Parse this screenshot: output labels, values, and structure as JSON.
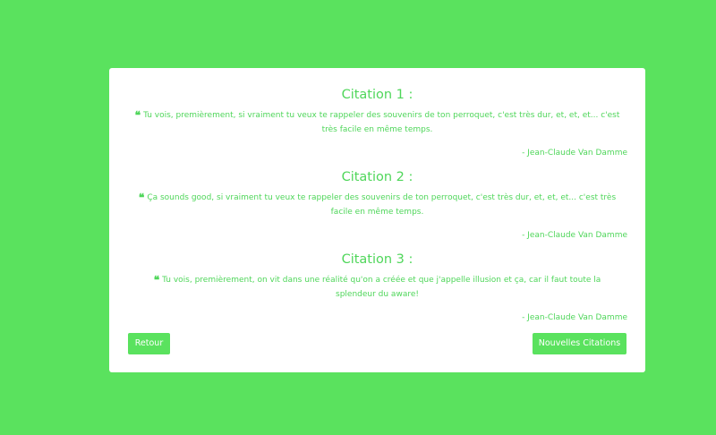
{
  "citations": [
    {
      "title": "Citation 1 :",
      "text": "Tu vois, premièrement, si vraiment tu veux te rappeler des souvenirs de ton perroquet, c'est très dur, et, et, et... c'est très facile en même temps.",
      "author": "- Jean-Claude Van Damme"
    },
    {
      "title": "Citation 2 :",
      "text": "Ça sounds good, si vraiment tu veux te rappeler des souvenirs de ton perroquet, c'est très dur, et, et, et... c'est très facile en même temps.",
      "author": "- Jean-Claude Van Damme"
    },
    {
      "title": "Citation 3 :",
      "text": "Tu vois, premièrement, on vit dans une réalité qu'on a créée et que j'appelle illusion et ça, car il faut toute la splendeur du aware!",
      "author": "- Jean-Claude Van Damme"
    }
  ],
  "buttons": {
    "retour": "Retour",
    "nouvelles": "Nouvelles Citations"
  },
  "icons": {
    "quote": "quote-left-icon"
  },
  "colors": {
    "background": "#5ae25e",
    "accent_text": "#4fd65a",
    "card": "#ffffff",
    "button_text": "#ffffff"
  }
}
